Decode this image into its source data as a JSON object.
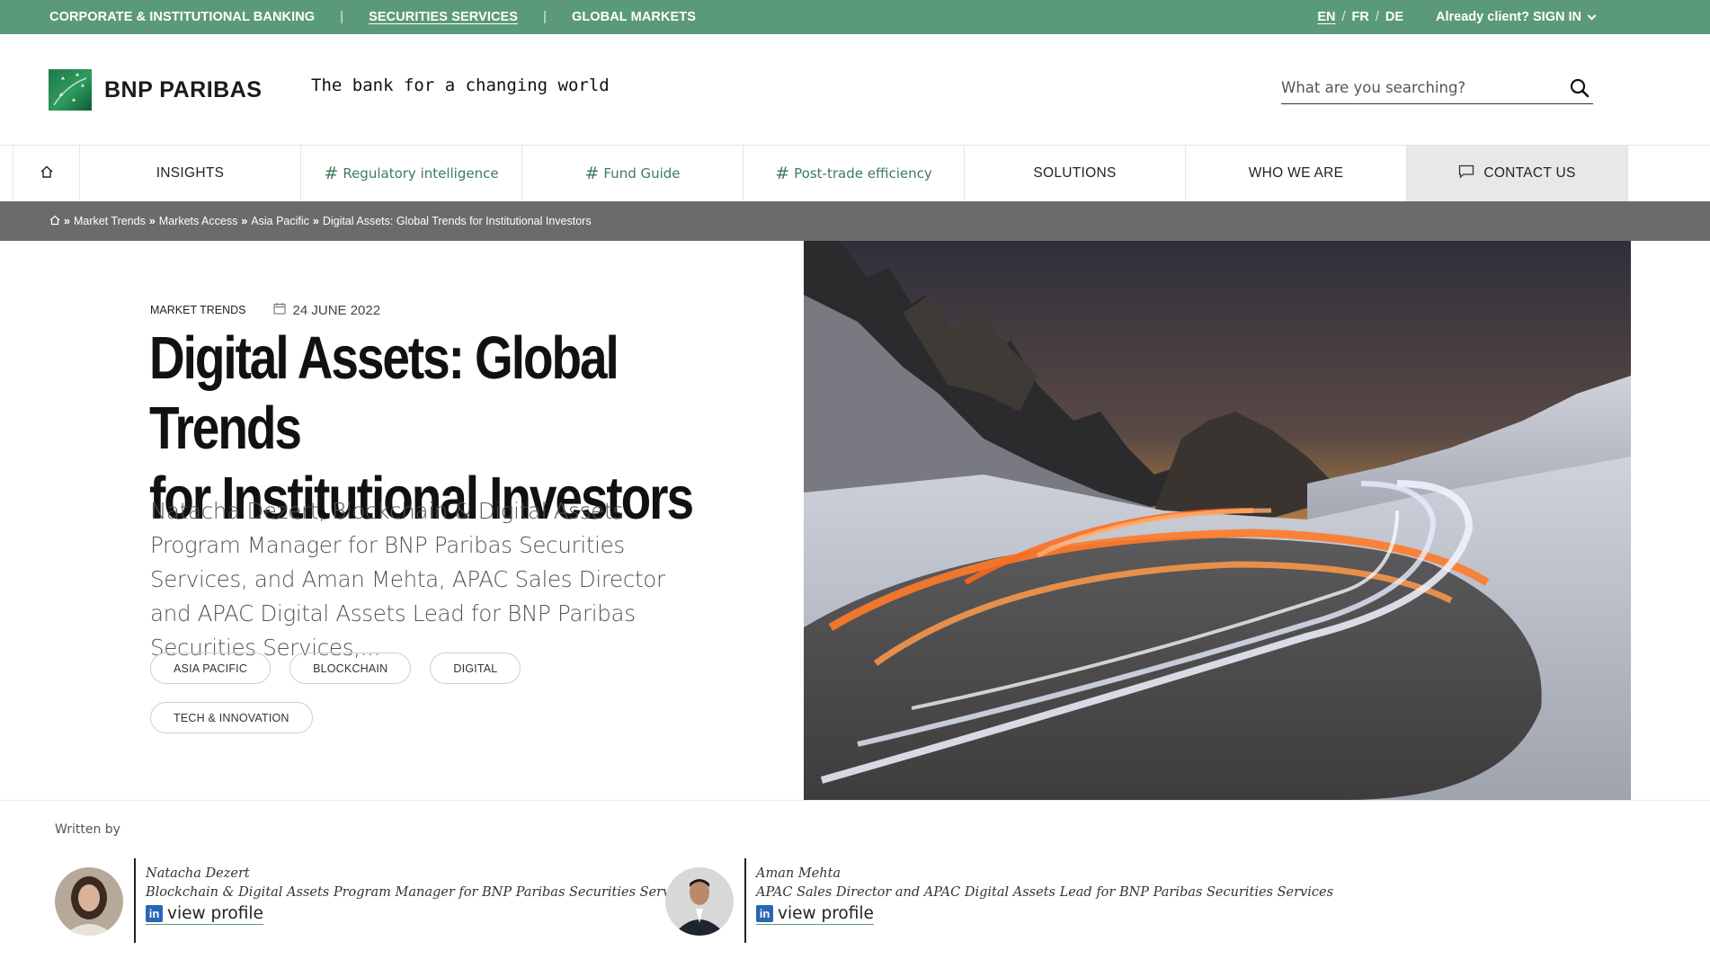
{
  "topbar": {
    "links": [
      "CORPORATE & INSTITUTIONAL BANKING",
      "SECURITIES SERVICES",
      "GLOBAL MARKETS"
    ],
    "languages": [
      "EN",
      "FR",
      "DE"
    ],
    "signin_label": "Already client? SIGN IN"
  },
  "header": {
    "logo_text": "BNP PARIBAS",
    "tagline": "The bank for a changing world",
    "search_placeholder": "What are you searching?"
  },
  "nav": {
    "items": [
      {
        "label": "INSIGHTS"
      },
      {
        "label": "Regulatory intelligence",
        "hash": "#"
      },
      {
        "label": "Fund Guide",
        "hash": "#"
      },
      {
        "label": "Post-trade efficiency",
        "hash": "#"
      },
      {
        "label": "SOLUTIONS"
      },
      {
        "label": "WHO WE ARE"
      },
      {
        "label": "CONTACT US"
      }
    ]
  },
  "breadcrumb": {
    "separator": "»",
    "items": [
      "Market Trends",
      "Markets Access",
      "Asia Pacific",
      "Digital Assets: Global Trends for Institutional Investors"
    ]
  },
  "article": {
    "category": "MARKET TRENDS",
    "date": "24 JUNE 2022",
    "title_line1": "Digital Assets: Global Trends",
    "title_line2": "for Institutional Investors",
    "summary": "Natacha Dezert, Blockchain & Digital Assets Program Manager for BNP Paribas Securities Services, and Aman Mehta, APAC Sales Director and APAC Digital Assets Lead for BNP Paribas Securities Services,...",
    "tags": [
      "ASIA PACIFIC",
      "BLOCKCHAIN",
      "DIGITAL",
      "TECH & INNOVATION"
    ]
  },
  "authors": {
    "label": "Written by",
    "profile_label": "view profile",
    "list": [
      {
        "name": "Natacha Dezert",
        "role": "Blockchain & Digital Assets Program Manager for BNP Paribas Securities Services"
      },
      {
        "name": "Aman Mehta",
        "role": "APAC Sales Director and APAC Digital Assets Lead for BNP Paribas Securities Services"
      }
    ]
  },
  "colors": {
    "brand_green": "#5b9a78",
    "breadcrumb_bg": "#6b6b6b",
    "tag_green": "#3e7d5a"
  }
}
